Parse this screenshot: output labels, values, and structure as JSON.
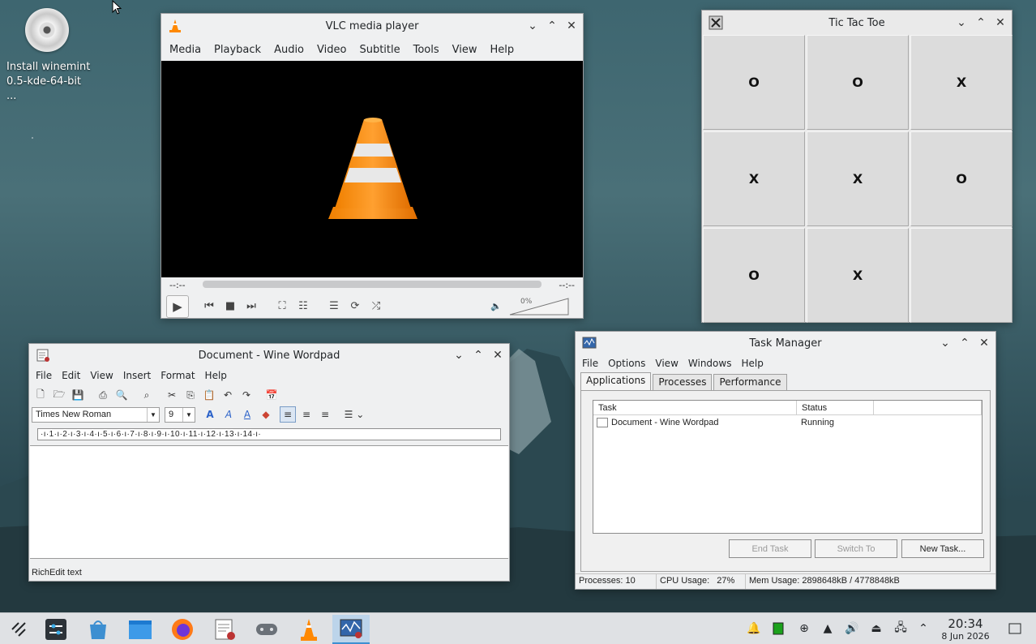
{
  "desktop": {
    "icon_label": "Install winemint 0.5-kde-64-bit ..."
  },
  "vlc": {
    "title": "VLC media player",
    "menu": [
      "Media",
      "Playback",
      "Audio",
      "Video",
      "Subtitle",
      "Tools",
      "View",
      "Help"
    ],
    "time_elapsed": "--:--",
    "time_total": "--:--",
    "volume_percent": "0%",
    "volume_level": 0
  },
  "tictactoe": {
    "title": "Tic Tac Toe",
    "board": [
      "O",
      "O",
      "X",
      "X",
      "X",
      "O",
      "O",
      "X",
      ""
    ]
  },
  "wordpad": {
    "title": "Document - Wine Wordpad",
    "menu": [
      "File",
      "Edit",
      "View",
      "Insert",
      "Format",
      "Help"
    ],
    "font_name": "Times New Roman",
    "font_size": "9",
    "ruler": "·ı·1·ı·2·ı·3·ı·4·ı·5·ı·6·ı·7·ı·8·ı·9·ı·10·ı·11·ı·12·ı·13·ı·14·ı·",
    "status": "RichEdit text"
  },
  "taskmanager": {
    "title": "Task Manager",
    "menu": [
      "File",
      "Options",
      "View",
      "Windows",
      "Help"
    ],
    "tabs": [
      "Applications",
      "Processes",
      "Performance"
    ],
    "active_tab": "Applications",
    "columns": [
      "Task",
      "Status"
    ],
    "rows": [
      {
        "task": "Document - Wine Wordpad",
        "status": "Running"
      }
    ],
    "buttons": {
      "end_task": "End Task",
      "switch_to": "Switch To",
      "new_task": "New Task..."
    },
    "status": {
      "processes": "Processes: 10",
      "cpu": "CPU Usage:   27%",
      "mem": "Mem Usage: 2898648kB / 4778848kB"
    }
  },
  "taskbar": {
    "time": "20:34",
    "date": "8 Jun 2026"
  },
  "colors": {
    "accent": "#3d8fd1",
    "vlc_orange": "#ff8800"
  }
}
